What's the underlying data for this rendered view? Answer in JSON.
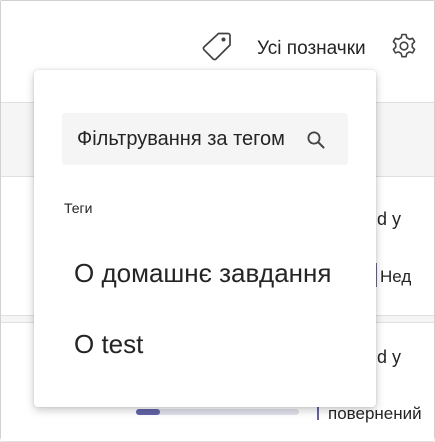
{
  "header": {
    "tag_icon": "tag-icon",
    "all_tags_label": "Усі позначки",
    "settings_icon": "gear-icon"
  },
  "background": {
    "card1_line1": "d y",
    "card1_line2": "Нед",
    "card2_line1": "d y",
    "card2_line2": "повернений",
    "progress_fraction": 0.15,
    "accent_color": "#6264a7"
  },
  "tag_filter": {
    "placeholder": "Фільтрування за тегом",
    "search_icon": "search-icon",
    "section_label": "Теги",
    "options": [
      {
        "label": "О домашнє завдання"
      },
      {
        "label": "О test"
      }
    ]
  }
}
